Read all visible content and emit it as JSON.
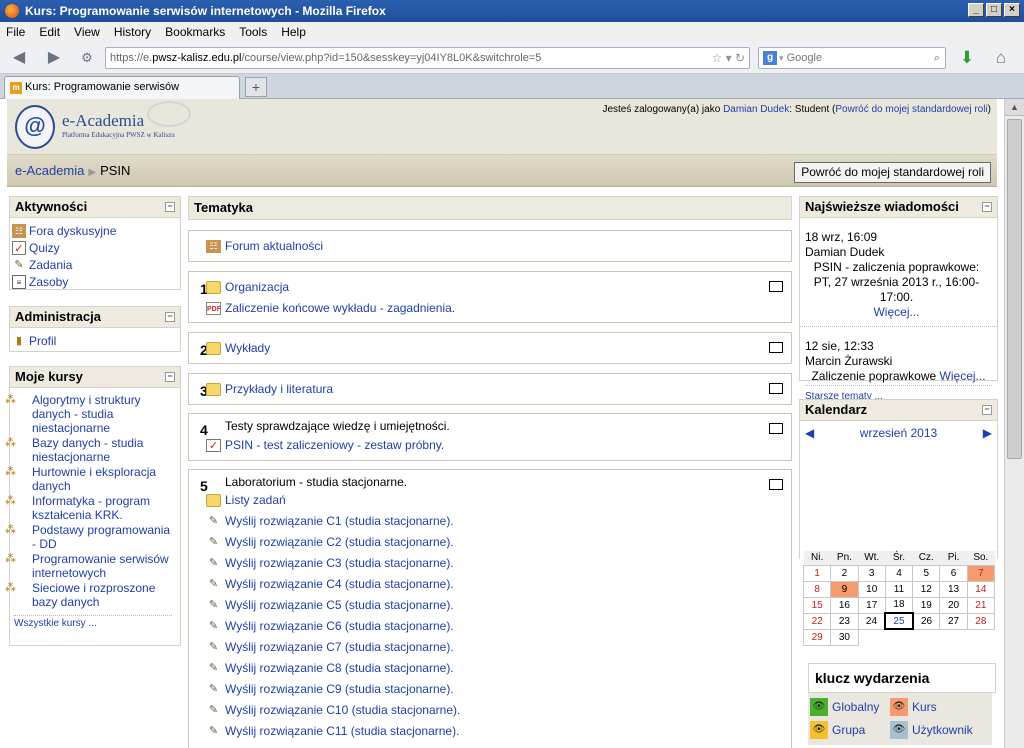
{
  "window": {
    "title": "Kurs: Programowanie serwisów internetowych - Mozilla Firefox"
  },
  "menu": [
    "File",
    "Edit",
    "View",
    "History",
    "Bookmarks",
    "Tools",
    "Help"
  ],
  "url": {
    "prefix": "https://e.",
    "domain": "pwsz-kalisz.edu.pl",
    "path": "/course/view.php?id=150&sesskey=yj04IY8L0K&switchrole=5"
  },
  "search": {
    "placeholder": "Google"
  },
  "tab": {
    "label": "Kurs: Programowanie serwisów internetowych"
  },
  "site": {
    "name": "e-Academia",
    "subtitle": "Platforma Edukacyjna PWSZ w Kaliszu"
  },
  "login": {
    "prefix": "Jesteś zalogowany(a) jako",
    "user": "Damian Dudek",
    "role": ": Student (",
    "back": "Powróć do mojej standardowej roli",
    ")": ")"
  },
  "breadcrumb": {
    "home": "e-Academia",
    "current": "PSIN"
  },
  "role_button": "Powróć do mojej standardowej roli",
  "activities": {
    "title": "Aktywności",
    "items": [
      "Fora dyskusyjne",
      "Quizy",
      "Zadania",
      "Zasoby"
    ]
  },
  "admin": {
    "title": "Administracja",
    "items": [
      "Profil"
    ]
  },
  "mycourses": {
    "title": "Moje kursy",
    "items": [
      "Algorytmy i struktury danych - studia niestacjonarne",
      "Bazy danych - studia niestacjonarne",
      "Hurtownie i eksploracja danych",
      "Informatyka - program kształcenia KRK.",
      "Podstawy programowania - DD",
      "Programowanie serwisów internetowych",
      "Sieciowe i rozproszone bazy danych"
    ],
    "all": "Wszystkie kursy ..."
  },
  "topics": {
    "title": "Tematyka",
    "forum": "Forum aktualności"
  },
  "sections": {
    "s1": {
      "num": "1",
      "items": [
        "Organizacja",
        "Zaliczenie końcowe wykładu - zagadnienia."
      ]
    },
    "s2": {
      "num": "2",
      "items": [
        "Wykłady"
      ]
    },
    "s3": {
      "num": "3",
      "items": [
        "Przykłady i literatura"
      ]
    },
    "s4": {
      "num": "4",
      "summary": "Testy sprawdzające wiedzę i umiejętności.",
      "items": [
        "PSIN - test zaliczeniowy - zestaw próbny."
      ]
    },
    "s5": {
      "num": "5",
      "summary": "Laboratorium - studia stacjonarne.",
      "folder": "Listy zadań",
      "items": [
        "Wyślij rozwiązanie C1 (studia stacjonarne).",
        "Wyślij rozwiązanie C2 (studia stacjonarne).",
        "Wyślij rozwiązanie C3 (studia stacjonarne).",
        "Wyślij rozwiązanie C4 (studia stacjonarne).",
        "Wyślij rozwiązanie C5 (studia stacjonarne).",
        "Wyślij rozwiązanie C6 (studia stacjonarne).",
        "Wyślij rozwiązanie C7 (studia stacjonarne).",
        "Wyślij rozwiązanie C8 (studia stacjonarne).",
        "Wyślij rozwiązanie C9 (studia stacjonarne).",
        "Wyślij rozwiązanie C10 (studia stacjonarne).",
        "Wyślij rozwiązanie C11 (studia stacjonarne)."
      ]
    }
  },
  "news": {
    "title": "Najświeższe wiadomości",
    "n1": {
      "date": "18 wrz, 16:09",
      "author": "Damian Dudek",
      "text": "PSIN - zaliczenia poprawkowe: PT, 27 września 2013 r., 16:00-17:00.",
      "more": "Więcej..."
    },
    "n2": {
      "date": "12 sie, 12:33",
      "author": "Marcin Żurawski",
      "text": "Zaliczenie poprawkowe",
      "more": "Więcej..."
    },
    "older": "Starsze tematy ..."
  },
  "calendar": {
    "title": "Kalendarz",
    "month": "wrzesień 2013",
    "days": [
      "Ni.",
      "Pn.",
      "Wt.",
      "Śr.",
      "Cz.",
      "Pi.",
      "So."
    ],
    "weeks": [
      [
        "1",
        "2",
        "3",
        "4",
        "5",
        "6",
        "7"
      ],
      [
        "8",
        "9",
        "10",
        "11",
        "12",
        "13",
        "14"
      ],
      [
        "15",
        "16",
        "17",
        "18",
        "19",
        "20",
        "21"
      ],
      [
        "22",
        "23",
        "24",
        "25",
        "26",
        "27",
        "28"
      ],
      [
        "29",
        "30",
        "",
        "",
        "",
        "",
        ""
      ]
    ],
    "event_days": [
      "7",
      "9"
    ],
    "today": "25"
  },
  "legend": {
    "title": "klucz wydarzenia",
    "global": "Globalny",
    "course": "Kurs",
    "group": "Grupa",
    "user": "Użytkownik"
  },
  "colors": {
    "global": "#4caf2e",
    "course": "#f59b6e",
    "group": "#f2c12e",
    "user": "#a8bfd0"
  }
}
